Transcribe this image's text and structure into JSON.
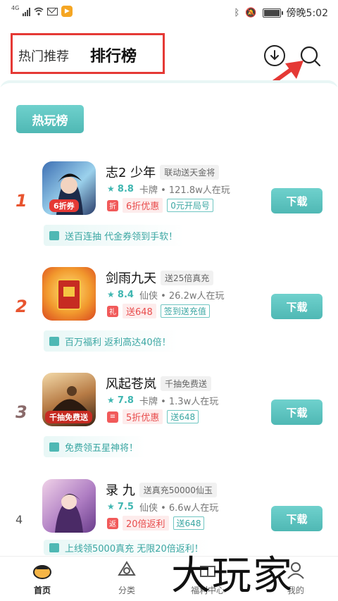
{
  "status_bar": {
    "network": "4G",
    "time_label": "傍晚5:02"
  },
  "header": {
    "tab_hot": "热门推荐",
    "tab_rank": "排行榜"
  },
  "hot_button": "热玩榜",
  "download_label": "下载",
  "games": [
    {
      "rank": "1",
      "name": "志2 少年",
      "tag": "联动送天金将",
      "score": "8.8",
      "category": "卡牌",
      "players": "121.8w人在玩",
      "promo_icon": "折",
      "promo": "6折优惠",
      "promo_tag": "0元开局号",
      "benefit": "送百连抽 代金券领到手软！",
      "thumb_badge": "6折券",
      "rank_color": "#e8542f"
    },
    {
      "rank": "2",
      "name": "剑雨九天",
      "tag": "送25倍真充",
      "score": "8.4",
      "category": "仙侠",
      "players": "26.2w人在玩",
      "promo_icon": "礼",
      "promo": "送648",
      "promo_tag": "签到送充值",
      "benefit": "百万福利 返利高达40倍！",
      "thumb_badge": "",
      "rank_color": "#e8542f"
    },
    {
      "rank": "3",
      "name": "风起苍岚",
      "tag": "千抽免费送",
      "score": "7.8",
      "category": "卡牌",
      "players": "1.3w人在玩",
      "promo_icon": "≡",
      "promo": "5折优惠",
      "promo_tag": "送648",
      "benefit": "免费领五星神将！",
      "thumb_badge": "千抽免费送",
      "rank_color": "#8a6a6a"
    },
    {
      "rank": "4",
      "name": "录 九",
      "tag": "送真充50000仙玉",
      "score": "7.5",
      "category": "仙侠",
      "players": "6.6w人在玩",
      "promo_icon": "返",
      "promo": "20倍返利",
      "promo_tag": "送648",
      "benefit": "上线领5000真充 无限20倍返利！",
      "thumb_badge": "",
      "rank_color": "#555555"
    }
  ],
  "nav": {
    "home": "首页",
    "category": "分类",
    "welfare": "福利中心",
    "mine": "我的"
  },
  "watermark": "大玩家"
}
